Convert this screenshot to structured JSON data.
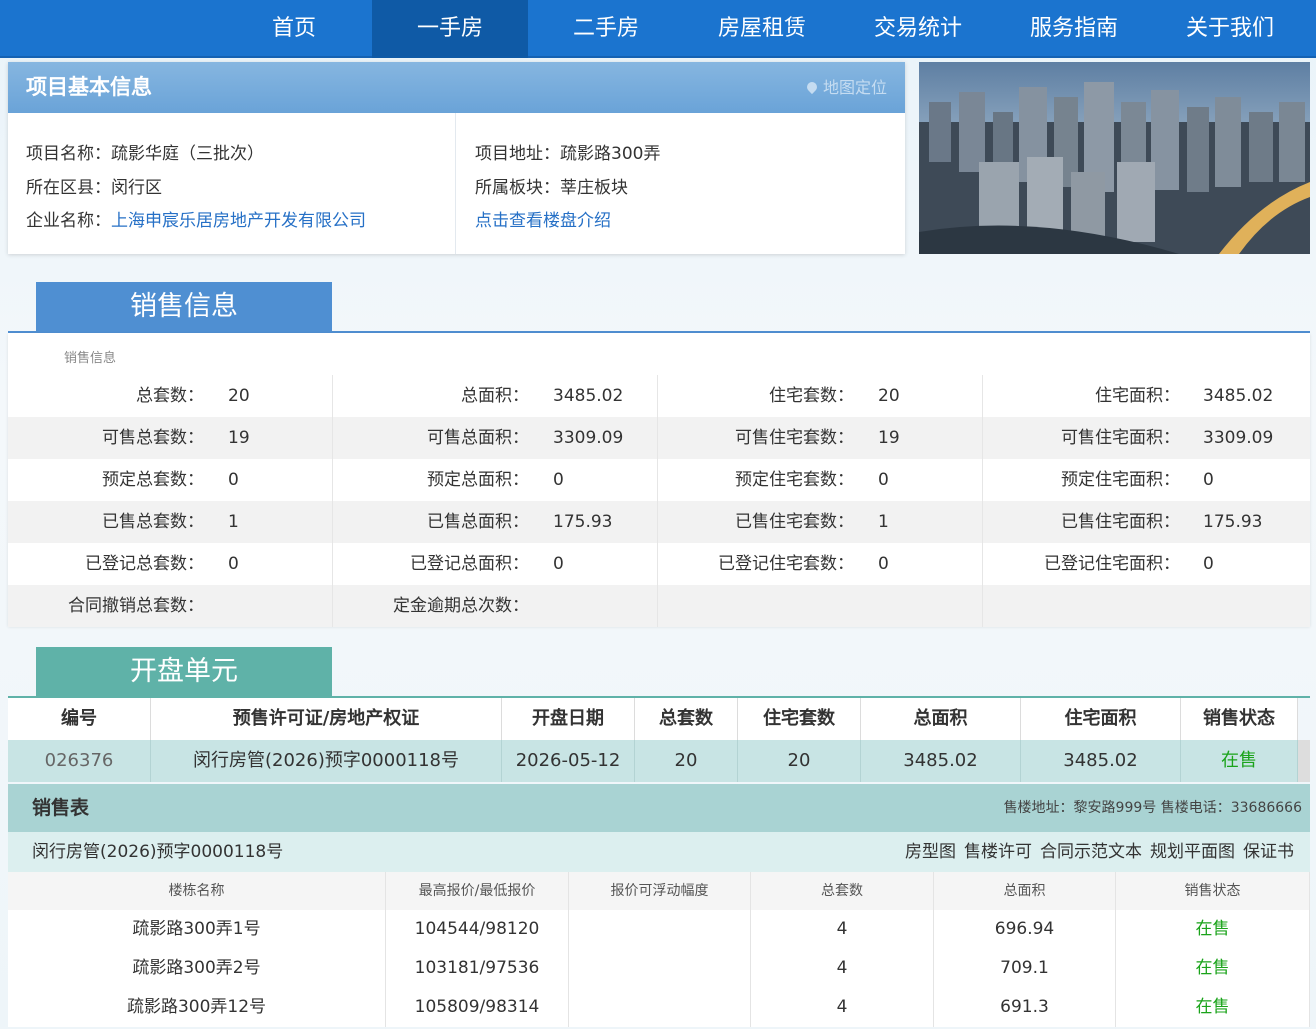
{
  "nav": {
    "items": [
      "首页",
      "一手房",
      "二手房",
      "房屋租赁",
      "交易统计",
      "服务指南",
      "关于我们"
    ],
    "active": "一手房"
  },
  "project": {
    "header": "项目基本信息",
    "map_link": "地图定位",
    "name_label": "项目名称：",
    "name": "疏影华庭（三批次）",
    "district_label": "所在区县：",
    "district": "闵行区",
    "company_label": "企业名称：",
    "company": "上海申宸乐居房地产开发有限公司",
    "address_label": "项目地址：",
    "address": "疏影路300弄",
    "block_label": "所属板块：",
    "block": "莘庄板块",
    "intro_link": "点击查看楼盘介绍"
  },
  "sales_info": {
    "tab": "销售信息",
    "caption": "销售信息",
    "rows": [
      [
        [
          "总套数：",
          "20"
        ],
        [
          "总面积：",
          "3485.02"
        ],
        [
          "住宅套数：",
          "20"
        ],
        [
          "住宅面积：",
          "3485.02"
        ]
      ],
      [
        [
          "可售总套数：",
          "19"
        ],
        [
          "可售总面积：",
          "3309.09"
        ],
        [
          "可售住宅套数：",
          "19"
        ],
        [
          "可售住宅面积：",
          "3309.09"
        ]
      ],
      [
        [
          "预定总套数：",
          "0"
        ],
        [
          "预定总面积：",
          "0"
        ],
        [
          "预定住宅套数：",
          "0"
        ],
        [
          "预定住宅面积：",
          "0"
        ]
      ],
      [
        [
          "已售总套数：",
          "1"
        ],
        [
          "已售总面积：",
          "175.93"
        ],
        [
          "已售住宅套数：",
          "1"
        ],
        [
          "已售住宅面积：",
          "175.93"
        ]
      ],
      [
        [
          "已登记总套数：",
          "0"
        ],
        [
          "已登记总面积：",
          "0"
        ],
        [
          "已登记住宅套数：",
          "0"
        ],
        [
          "已登记住宅面积：",
          "0"
        ]
      ],
      [
        [
          "合同撤销总套数：",
          ""
        ],
        [
          "定金逾期总次数：",
          ""
        ],
        [
          "",
          ""
        ],
        [
          "",
          ""
        ]
      ]
    ]
  },
  "open_units": {
    "tab": "开盘单元",
    "headers": [
      "编号",
      "预售许可证/房地产权证",
      "开盘日期",
      "总套数",
      "住宅套数",
      "总面积",
      "住宅面积",
      "销售状态"
    ],
    "rows": [
      [
        "026376",
        "闵行房管(2026)预字0000118号",
        "2026-05-12",
        "20",
        "20",
        "3485.02",
        "3485.02",
        "在售"
      ]
    ],
    "status_color": "#1aa31a"
  },
  "sales_table": {
    "title": "销售表",
    "contact": "售楼地址：黎安路999号 售楼电话：33686666",
    "permit": "闵行房管(2026)预字0000118号",
    "links": [
      "房型图",
      "售楼许可",
      "合同示范文本",
      "规划平面图",
      "保证书"
    ],
    "headers": [
      "楼栋名称",
      "最高报价/最低报价",
      "报价可浮动幅度",
      "总套数",
      "总面积",
      "销售状态"
    ],
    "rows": [
      [
        "疏影路300弄1号",
        "104544/98120",
        "",
        "4",
        "696.94",
        "在售"
      ],
      [
        "疏影路300弄2号",
        "103181/97536",
        "",
        "4",
        "709.1",
        "在售"
      ],
      [
        "疏影路300弄12号",
        "105809/98314",
        "",
        "4",
        "691.3",
        "在售"
      ]
    ]
  }
}
